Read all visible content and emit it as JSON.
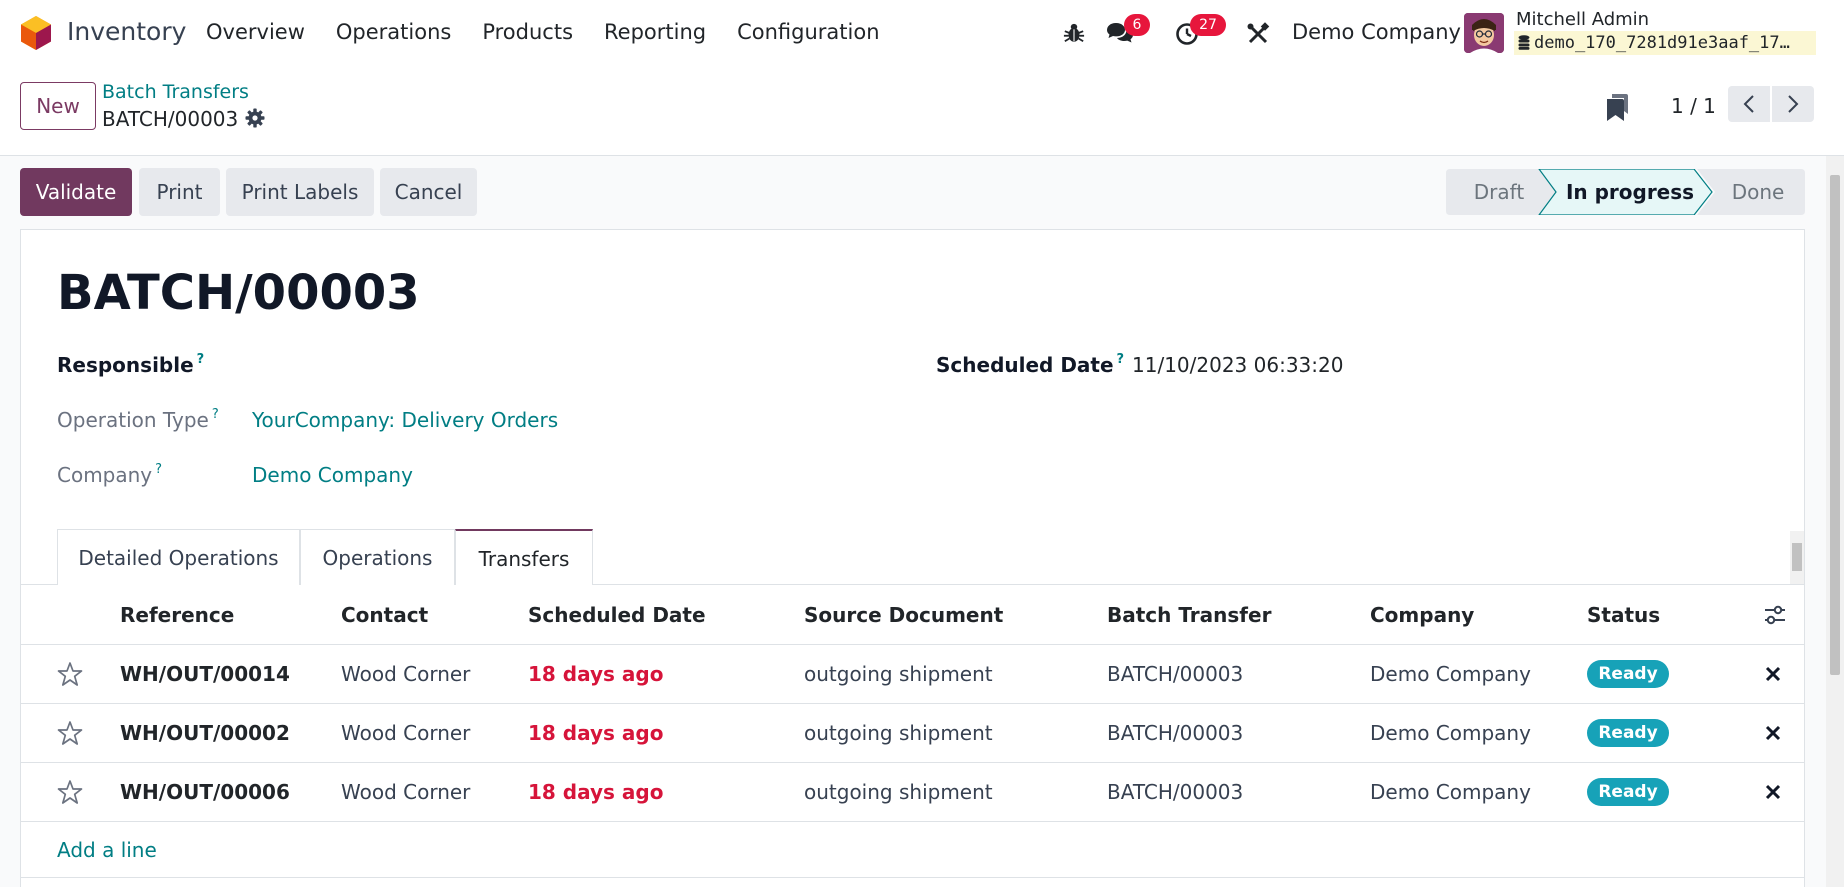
{
  "navbar": {
    "app_name": "Inventory",
    "menu": [
      "Overview",
      "Operations",
      "Products",
      "Reporting",
      "Configuration"
    ],
    "chat_badge": "6",
    "activity_badge": "27",
    "company": "Demo Company",
    "user_name": "Mitchell Admin",
    "database": "demo_170_7281d91e3aaf_17…"
  },
  "control_panel": {
    "new_label": "New",
    "breadcrumb_parent": "Batch Transfers",
    "breadcrumb_current": "BATCH/00003",
    "pager_value": "1 / 1"
  },
  "actions": {
    "validate": "Validate",
    "print": "Print",
    "print_labels": "Print Labels",
    "cancel": "Cancel"
  },
  "statusbar": {
    "steps": [
      "Draft",
      "In progress",
      "Done"
    ],
    "current": "In progress"
  },
  "record": {
    "title": "BATCH/00003",
    "responsible_label": "Responsible",
    "responsible_value": "",
    "scheduled_date_label": "Scheduled Date",
    "scheduled_date_value": "11/10/2023 06:33:20",
    "operation_type_label": "Operation Type",
    "operation_type_value": "YourCompany: Delivery Orders",
    "company_label": "Company",
    "company_value": "Demo Company",
    "help_mark": "?"
  },
  "tabs": [
    "Detailed Operations",
    "Operations",
    "Transfers"
  ],
  "active_tab": "Transfers",
  "table": {
    "columns": [
      "Reference",
      "Contact",
      "Scheduled Date",
      "Source Document",
      "Batch Transfer",
      "Company",
      "Status"
    ],
    "rows": [
      {
        "reference": "WH/OUT/00014",
        "contact": "Wood Corner",
        "scheduled": "18 days ago",
        "source": "outgoing shipment",
        "batch": "BATCH/00003",
        "company": "Demo Company",
        "status": "Ready"
      },
      {
        "reference": "WH/OUT/00002",
        "contact": "Wood Corner",
        "scheduled": "18 days ago",
        "source": "outgoing shipment",
        "batch": "BATCH/00003",
        "company": "Demo Company",
        "status": "Ready"
      },
      {
        "reference": "WH/OUT/00006",
        "contact": "Wood Corner",
        "scheduled": "18 days ago",
        "source": "outgoing shipment",
        "batch": "BATCH/00003",
        "company": "Demo Company",
        "status": "Ready"
      }
    ],
    "add_line": "Add a line"
  },
  "colors": {
    "brand": "#71395f",
    "link": "#017e84",
    "danger": "#d6143a",
    "badge_info": "#17a2b8",
    "notification": "#e7163c"
  },
  "icons": [
    "app-logo",
    "bug-icon",
    "chat-icon",
    "clock-icon",
    "tools-icon",
    "database-icon",
    "gear-icon",
    "archive-icon",
    "chevron-left-icon",
    "chevron-right-icon",
    "optional-columns-icon",
    "star-icon",
    "remove-icon"
  ]
}
